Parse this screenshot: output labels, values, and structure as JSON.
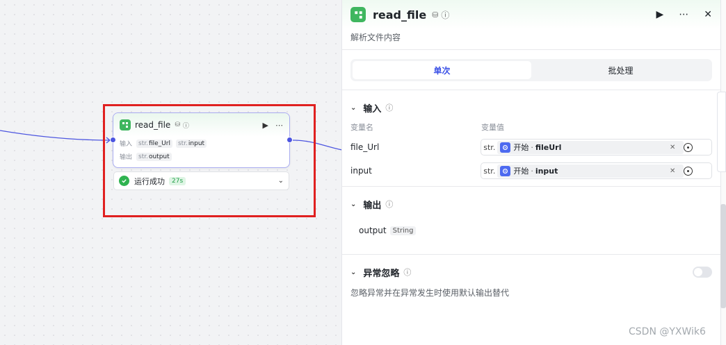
{
  "node": {
    "title": "read_file",
    "input_label": "输入",
    "output_label": "输出",
    "inputs": [
      {
        "type": "str.",
        "name": "file_Url"
      },
      {
        "type": "str.",
        "name": "input"
      }
    ],
    "outputs": [
      {
        "type": "str.",
        "name": "output"
      }
    ],
    "status_text": "运行成功",
    "duration": "27s"
  },
  "panel": {
    "title": "read_file",
    "description": "解析文件内容",
    "tabs": [
      {
        "label": "单次",
        "active": true
      },
      {
        "label": "批处理",
        "active": false
      }
    ],
    "input_section": {
      "title": "输入",
      "col_name": "变量名",
      "col_value": "变量值",
      "rows": [
        {
          "name": "file_Url",
          "type_tag": "str.",
          "source": "开始",
          "separator": "·",
          "field": "fileUrl"
        },
        {
          "name": "input",
          "type_tag": "str.",
          "source": "开始",
          "separator": "·",
          "field": "input"
        }
      ]
    },
    "output_section": {
      "title": "输出",
      "name": "output",
      "type": "String"
    },
    "exception_section": {
      "title": "异常忽略",
      "description": "忽略异常并在异常发生时使用默认输出替代",
      "enabled": false
    }
  },
  "watermark": "CSDN @YXWik6",
  "colors": {
    "accent": "#3a50e6",
    "success": "#2fb350",
    "highlight_border": "#e02020",
    "plugin_green": "#3fb65f"
  },
  "icons": {
    "node_logo": "plugin-icon",
    "run": "play-icon",
    "more": "more-icon",
    "close": "close-icon",
    "status": "check-circle-icon",
    "expand": "chevron-down-icon",
    "reference": "start-node-icon",
    "clear": "clear-icon",
    "picker": "target-icon"
  }
}
